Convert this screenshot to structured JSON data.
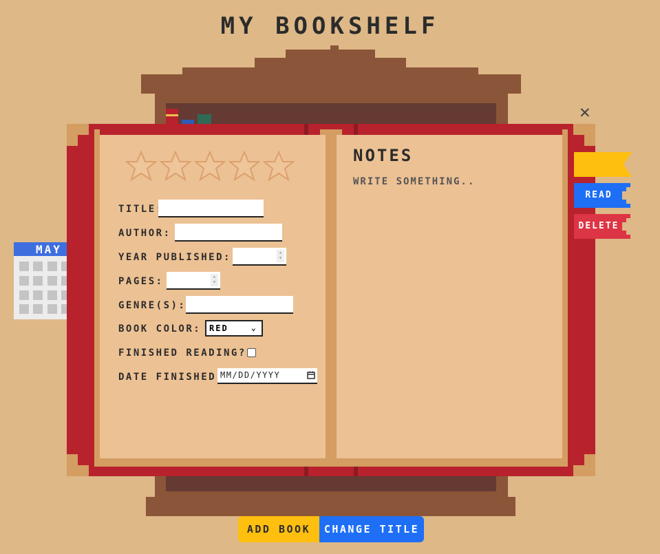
{
  "header": {
    "title": "MY BOOKSHELF"
  },
  "calendar": {
    "month": "MAY"
  },
  "book_form": {
    "rating_stars": 5,
    "rating_value": 0,
    "title_label": "TITLE:",
    "title_value": "",
    "author_label": "AUTHOR:",
    "author_value": "",
    "year_label": "YEAR PUBLISHED:",
    "year_value": "",
    "pages_label": "PAGES:",
    "pages_value": "",
    "genres_label": "GENRE(S):",
    "genres_value": "",
    "color_label": "BOOK COLOR:",
    "color_value": "RED",
    "finished_label": "FINISHED READING?",
    "finished_checked": false,
    "date_label": "DATE FINISHED:",
    "date_placeholder": "MM/DD/YYYY"
  },
  "notes": {
    "title": "NOTES",
    "placeholder": "WRITE SOMETHING.."
  },
  "side_tabs": {
    "bookmark_label": "",
    "read_label": "READ",
    "delete_label": "DELETE"
  },
  "buttons": {
    "add_book": "ADD BOOK",
    "change_title": "CHANGE TITLE"
  },
  "colors": {
    "background": "#deb887",
    "cover": "#b8222d",
    "page": "#ecc194",
    "shelf": "#8b5539",
    "yellow": "#ffbf0f",
    "blue": "#1e6ff5",
    "delete": "#dc3545"
  }
}
